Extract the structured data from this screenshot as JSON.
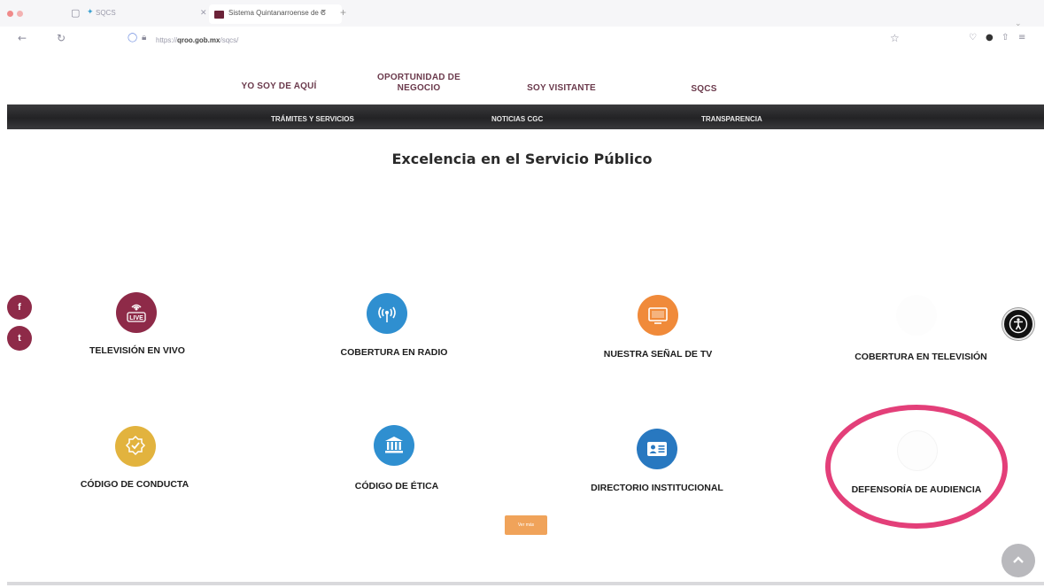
{
  "browser": {
    "tabs": [
      {
        "title": "SQCS"
      },
      {
        "title": "Sistema Quintanarroense de C",
        "close": "✕"
      }
    ],
    "new_tab": "+",
    "url_prefix": "https://",
    "url_domain": "qroo.gob.mx",
    "url_path": "/sqcs/"
  },
  "top_nav": [
    "YO SOY DE AQUÍ",
    "OPORTUNIDAD DE NEGOCIO",
    "SOY VISITANTE",
    "SQCS"
  ],
  "secondary_nav": [
    "TRÁMITES Y SERVICIOS",
    "NOTICIAS CGC",
    "TRANSPARENCIA"
  ],
  "page_title": "Excelencia en el Servicio Público",
  "cards": [
    {
      "label": "TELEVISIÓN EN VIVO",
      "icon": "live-broadcast-icon",
      "color": "#8e2a48"
    },
    {
      "label": "COBERTURA EN RADIO",
      "icon": "radio-antenna-icon",
      "color": "#2f8fd0"
    },
    {
      "label": "NUESTRA SEÑAL DE TV",
      "icon": "tv-icon",
      "color": "#f08a3a"
    },
    {
      "label": "COBERTURA EN TELEVISIÓN",
      "icon": "television-coverage-icon",
      "color": "#ffffff"
    },
    {
      "label": "CÓDIGO DE CONDUCTA",
      "icon": "badge-check-icon",
      "color": "#e2b33e"
    },
    {
      "label": "CÓDIGO DE ÉTICA",
      "icon": "institution-icon",
      "color": "#2f8fd0"
    },
    {
      "label": "DIRECTORIO INSTITUCIONAL",
      "icon": "id-card-icon",
      "color": "#2878c0"
    },
    {
      "label": "DEFENSORÍA DE AUDIENCIA",
      "icon": "audience-icon",
      "color": "#ffffff"
    }
  ],
  "live_badge": "LIVE",
  "ver_mas": "Ver más",
  "social": [
    "f",
    "t"
  ],
  "colors": {
    "accent_maroon": "#8e2a48",
    "navbar": "#2a2a2c",
    "highlight": "#e33f79",
    "button_orange": "#f0a35a"
  }
}
